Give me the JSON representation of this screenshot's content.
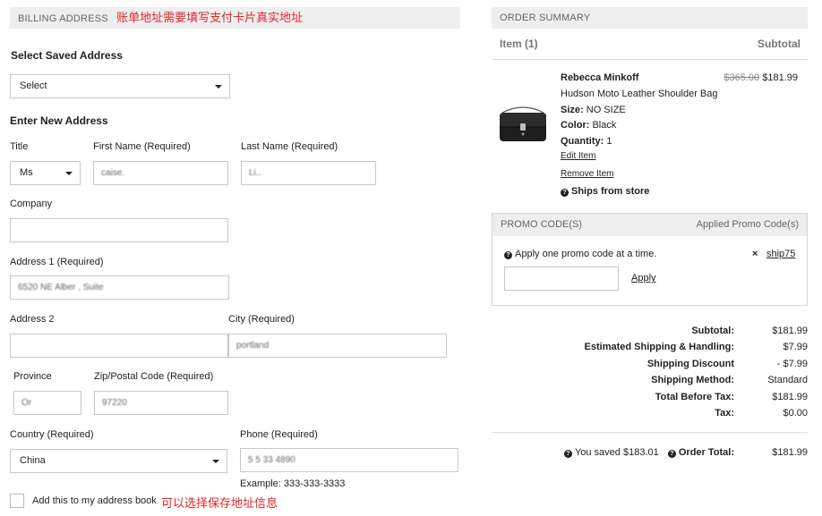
{
  "billing": {
    "header": "BILLING ADDRESS",
    "note_cn": "账单地址需要填写支付卡片真实地址",
    "saved_label": "Select Saved Address",
    "saved_select_value": "Select",
    "new_address_label": "Enter New Address",
    "title_label": "Title",
    "title_value": "Ms",
    "first_name_label": "First Name (Required)",
    "first_name_value": "caise.",
    "last_name_label": "Last Name (Required)",
    "last_name_value": "Li..",
    "company_label": "Company",
    "company_value": "",
    "address1_label": "Address 1 (Required)",
    "address1_value": "6520 NE Alber          , Suite",
    "address2_label": "Address 2",
    "address2_value": "",
    "city_label": "City (Required)",
    "city_value": "portland",
    "province_label": "Province",
    "province_value": "Or",
    "zip_label": "Zip/Postal Code (Required)",
    "zip_value": "97220",
    "country_label": "Country (Required)",
    "country_value": "China",
    "phone_label": "Phone (Required)",
    "phone_value": "5 5 33        4890",
    "phone_example": "Example: 333-333-3333",
    "address_book_label": "Add this to my address book",
    "address_book_note_cn": "可以选择保存地址信息"
  },
  "order": {
    "header": "ORDER SUMMARY",
    "item_col": "Item (1)",
    "subtotal_col": "Subtotal",
    "item": {
      "brand": "Rebecca Minkoff",
      "name": "Hudson Moto Leather Shoulder Bag",
      "size_label": "Size:",
      "size_value": "NO SIZE",
      "color_label": "Color:",
      "color_value": "Black",
      "quantity_label": "Quantity:",
      "quantity_value": "1",
      "original_price": "$365.00",
      "sale_price": "$181.99",
      "edit_link": "Edit Item",
      "remove_link": "Remove Item",
      "ships_from": "Ships from store"
    },
    "promo": {
      "header": "PROMO CODE(S)",
      "applied_header": "Applied Promo Code(s)",
      "hint": "Apply one promo code at a time.",
      "input_value": "",
      "apply_label": "Apply",
      "applied_code": "ship75",
      "remove_symbol": "×"
    },
    "summary": {
      "subtotal_label": "Subtotal:",
      "subtotal_value": "$181.99",
      "shipping_label": "Estimated Shipping & Handling:",
      "shipping_value": "$7.99",
      "discount_label": "Shipping Discount",
      "discount_value": "- $7.99",
      "method_label": "Shipping Method:",
      "method_value": "Standard",
      "before_tax_label": "Total Before Tax:",
      "before_tax_value": "$181.99",
      "tax_label": "Tax:",
      "tax_value": "$0.00",
      "saved_text": "You saved $183.01",
      "order_total_label": "Order Total:",
      "order_total_value": "$181.99"
    }
  },
  "colors": {
    "accent_red": "#e0262b",
    "header_bg": "#eeeeee",
    "border": "#c8c8c8"
  }
}
